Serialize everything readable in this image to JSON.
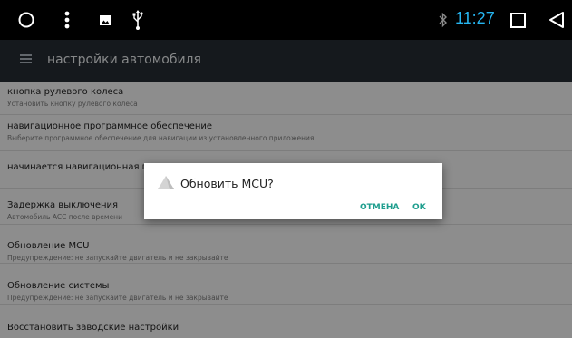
{
  "status_bar": {
    "time": "11:27",
    "time_color": "#26b5f0",
    "icons": [
      "circle-icon",
      "more-vert-icon",
      "image-icon",
      "usb-icon",
      "bluetooth-icon",
      "square-recent-icon",
      "back-triangle-icon"
    ]
  },
  "app_bar": {
    "title": "настройки автомобиля",
    "menu_icon": "hamburger-menu-icon"
  },
  "settings": [
    {
      "title": "кнопка рулевого колеса",
      "subtitle": "Установить кнопку рулевого колеса"
    },
    {
      "title": "навигационное программное обеспечение",
      "subtitle": "Выберите программное обеспечение для навигации из установленного приложения"
    },
    {
      "title": "начинается навигационная п",
      "subtitle": ""
    },
    {
      "title": "Задержка выключения",
      "subtitle": "Автомобиль ACC после времени"
    },
    {
      "title": "Обновление MCU",
      "subtitle": "Предупреждение: не запускайте двигатель и не закрывайте"
    },
    {
      "title": "Обновление системы",
      "subtitle": "Предупреждение: не запускайте двигатель и не закрывайте"
    },
    {
      "title": "Восстановить заводские настройки",
      "subtitle": ""
    }
  ],
  "dialog": {
    "title": "Обновить MCU?",
    "icon": "warning-icon",
    "cancel_label": "ОТМЕНА",
    "ok_label": "ОК",
    "accent_color": "#1e9e8e"
  }
}
